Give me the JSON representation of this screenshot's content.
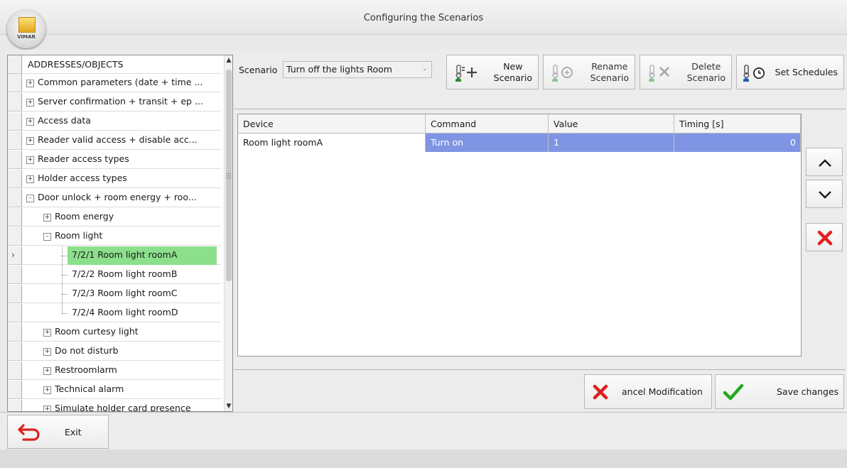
{
  "window": {
    "title": "Configuring the Scenarios",
    "logo_text": "VIMAR"
  },
  "tree": {
    "header": "ADDRESSES/OBJECTS",
    "items": [
      {
        "label": "Common parameters (date + time ...",
        "level": 0,
        "expander": "+"
      },
      {
        "label": "Server confirmation + transit + ep ...",
        "level": 0,
        "expander": "+"
      },
      {
        "label": "Access data",
        "level": 0,
        "expander": "+"
      },
      {
        "label": "Reader valid access + disable acc...",
        "level": 0,
        "expander": "+"
      },
      {
        "label": "Reader access types",
        "level": 0,
        "expander": "+"
      },
      {
        "label": "Holder access types",
        "level": 0,
        "expander": "+"
      },
      {
        "label": "Door unlock + room energy + roo...",
        "level": 0,
        "expander": "-"
      },
      {
        "label": "Room energy",
        "level": 1,
        "expander": "+"
      },
      {
        "label": "Room light",
        "level": 1,
        "expander": "-"
      },
      {
        "label": "7/2/1 Room light roomA",
        "level": 2,
        "selected": true
      },
      {
        "label": "7/2/2 Room light roomB",
        "level": 2
      },
      {
        "label": "7/2/3 Room light roomC",
        "level": 2
      },
      {
        "label": "7/2/4 Room light roomD",
        "level": 2
      },
      {
        "label": "Room curtesy light",
        "level": 1,
        "expander": "+"
      },
      {
        "label": "Do not disturb",
        "level": 1,
        "expander": "+"
      },
      {
        "label": "Restroomlarm",
        "level": 1,
        "expander": "+"
      },
      {
        "label": "Technical alarm",
        "level": 1,
        "expander": "+"
      },
      {
        "label": "Simulate holder card presence",
        "level": 1,
        "expander": "+"
      }
    ]
  },
  "scenario": {
    "label": "Scenario",
    "selected": "Turn off the lights Room"
  },
  "toolbar": {
    "new": "New\nScenario",
    "rename": "Rename\nScenario",
    "delete": "Delete\nScenario",
    "schedules": "Set Schedules"
  },
  "grid": {
    "columns": [
      "Device",
      "Command",
      "Value",
      "Timing [s]"
    ],
    "rows": [
      {
        "device": "Room light roomA",
        "command": "Turn on",
        "value": "1",
        "timing": "0"
      }
    ]
  },
  "actions": {
    "cancel": "ancel Modification",
    "save": "Save changes",
    "exit": "Exit"
  },
  "colors": {
    "selected_tree": "#8ce08c",
    "selected_grid": "#7f95e3",
    "delete_red": "#e02020",
    "check_green": "#1fa81f"
  }
}
